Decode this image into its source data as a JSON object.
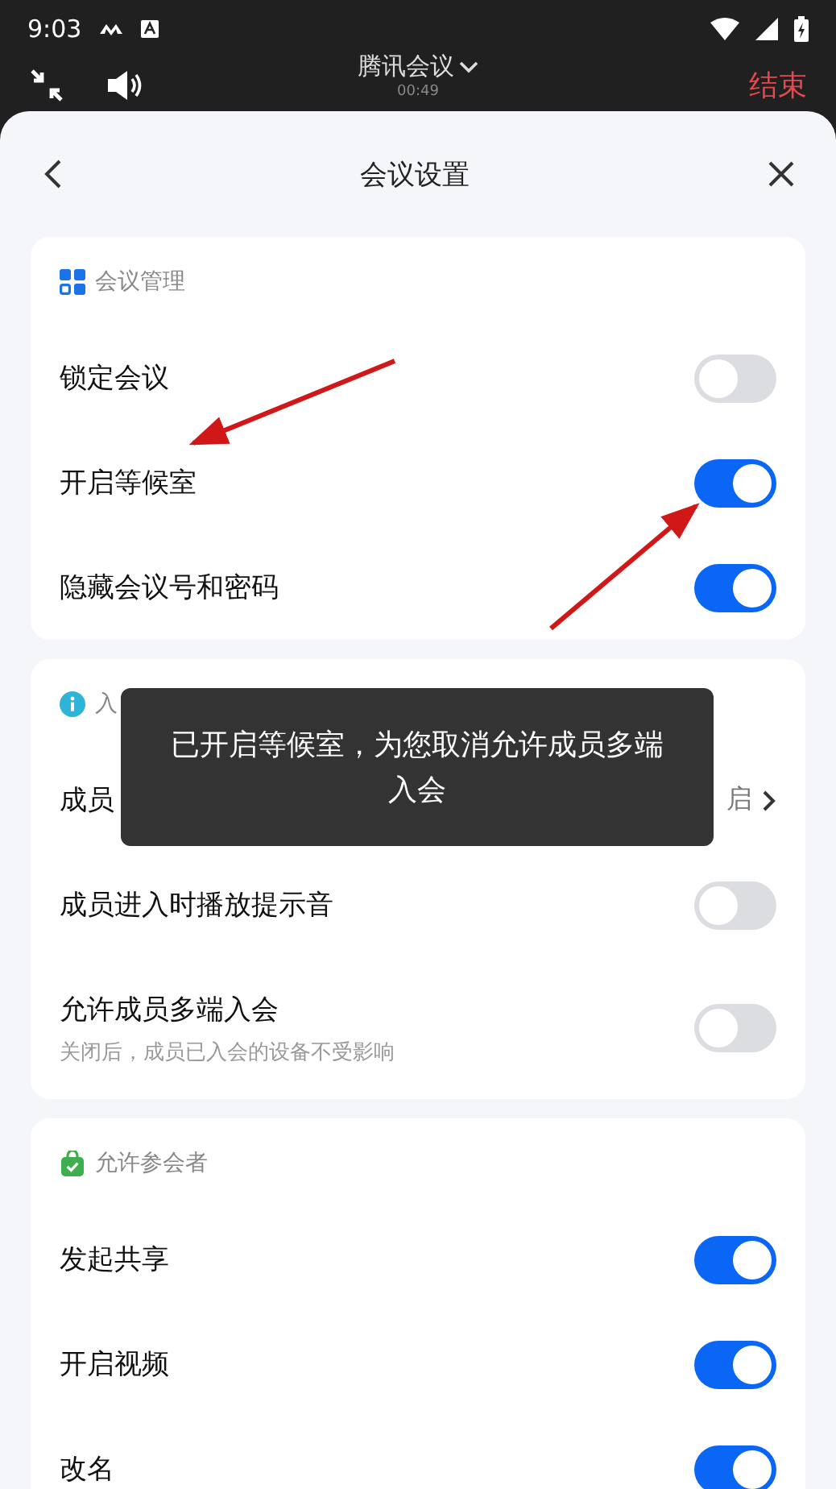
{
  "status_bar": {
    "time": "9:03"
  },
  "call_bar": {
    "title": "腾讯会议",
    "duration": "00:49",
    "end_label": "结束"
  },
  "sheet": {
    "title": "会议设置"
  },
  "sections": [
    {
      "title": "会议管理",
      "rows": [
        {
          "kind": "toggle",
          "label": "锁定会议",
          "on": false
        },
        {
          "kind": "toggle",
          "label": "开启等候室",
          "on": true
        },
        {
          "kind": "toggle",
          "label": "隐藏会议号和密码",
          "on": true
        }
      ]
    },
    {
      "title": "入",
      "rows": [
        {
          "kind": "link",
          "label": "成员",
          "value": "启"
        },
        {
          "kind": "toggle",
          "label": "成员进入时播放提示音",
          "on": false
        },
        {
          "kind": "toggle",
          "label": "允许成员多端入会",
          "description": "关闭后，成员已入会的设备不受影响",
          "on": false
        }
      ]
    },
    {
      "title": "允许参会者",
      "rows": [
        {
          "kind": "toggle",
          "label": "发起共享",
          "on": true
        },
        {
          "kind": "toggle",
          "label": "开启视频",
          "on": true
        },
        {
          "kind": "toggle",
          "label": "改名",
          "on": true
        }
      ]
    }
  ],
  "toast": {
    "message": "已开启等候室，为您取消允许成员多端入会"
  }
}
